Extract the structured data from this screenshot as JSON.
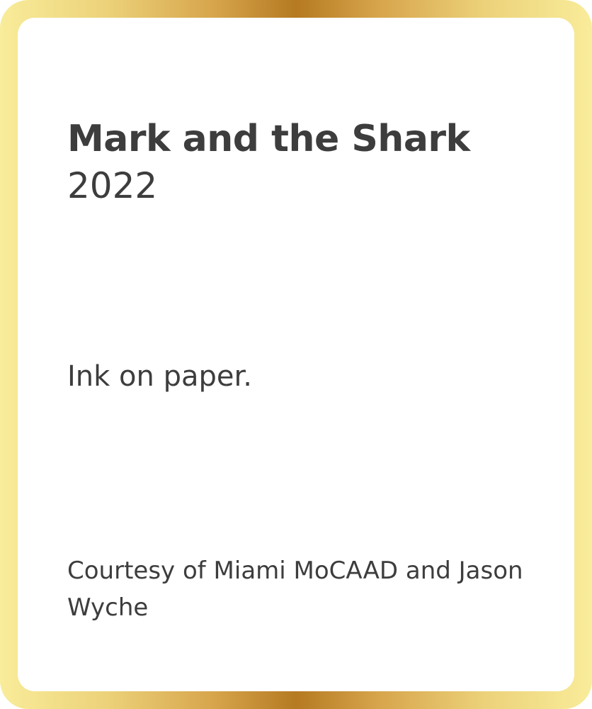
{
  "artwork": {
    "title": "Mark and the Shark",
    "year": "2022",
    "medium": "Ink on paper.",
    "credit": "Courtesy of Miami MoCAAD and Jason Wyche"
  },
  "colors": {
    "frame_gold_light": "#f9ec9a",
    "frame_gold_dark": "#b57a22",
    "text": "#3d3d3d",
    "background": "#ffffff"
  }
}
